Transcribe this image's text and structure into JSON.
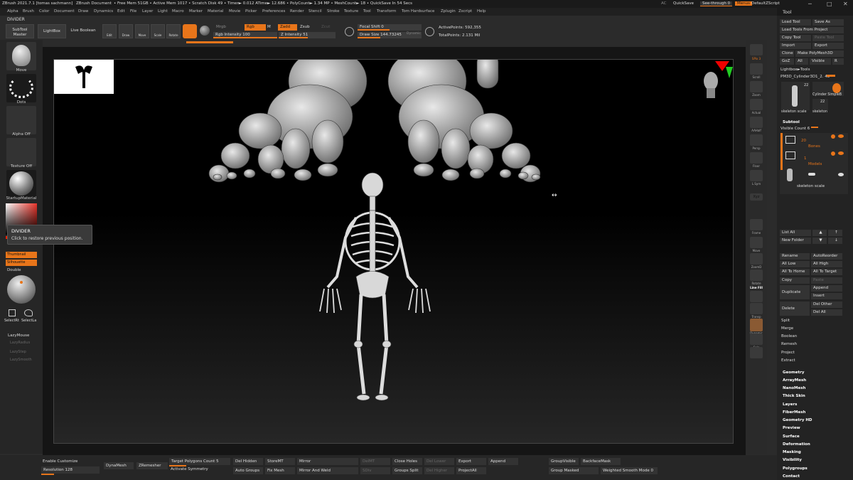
{
  "titlebar": {
    "app": "ZBrush 2021.7.1 [tomas sachmann]",
    "document": "ZBrush Document",
    "stats": "• Free Mem 51GB • Active Mem 1017 • Scratch Disk 49 • Timer► 0.012 ATime► 12.686 • PolyCount► 1.34 MP • MeshCount► 18 • QuickSave In 54 Secs",
    "ac": "AC",
    "quicksave": "QuickSave",
    "see_through": "See-through  0",
    "menus_btn": "Menus",
    "zscript": "DefaultZScript",
    "win_controls": [
      "─",
      "□",
      "✕"
    ]
  },
  "menubar": {
    "items": [
      "Alpha",
      "Brush",
      "Color",
      "Document",
      "Draw",
      "Dynamics",
      "Edit",
      "File",
      "Layer",
      "Light",
      "Macro",
      "Marker",
      "Material",
      "Movie",
      "Picker",
      "Preferences",
      "Render",
      "Stencil",
      "Stroke",
      "Texture",
      "Tool",
      "Transform",
      "Tom Hardsurface",
      "Zplugin",
      "Zscript",
      "Help"
    ]
  },
  "divider_label": "DIVIDER",
  "toolbar": {
    "subtool_master": "SubTool Master",
    "lightbox": "LightBox",
    "live_boolean": "Live Boolean",
    "edit": "Edit",
    "draw": "Draw",
    "move": "Move",
    "scale": "Scale",
    "rotate": "Rotate",
    "mrgb": "Mrgb",
    "rgb": "Rgb",
    "m": "M",
    "zadd": "Zadd",
    "zsub": "Zsub",
    "zcut": "Zcut",
    "rgb_intensity": "Rgb Intensity 100",
    "z_intensity": "Z Intensity 51",
    "focal_shift": "Focal Shift 0",
    "draw_size": "Draw Size 144.73245",
    "dynamic": "Dynamic",
    "active_points": "ActivePoints: 592,355",
    "total_points": "TotalPoints: 2.131 Mil"
  },
  "leftpanel": {
    "move": "Move",
    "dots": "Dots",
    "alpha_off": "Alpha Off",
    "texture_off": "Texture Off",
    "startup_material": "StartupMaterial",
    "gradient": "Gradient",
    "switch_color": "SwitchColor",
    "alternate": "Alternate",
    "thumbnail": "Thumbnail",
    "silhouette": "Silhouette",
    "double": "Double",
    "selectrect": "SelectRt",
    "selectlasso": "SelectLa",
    "lazymouse": "LazyMouse",
    "lazyradius": "LazyRadius",
    "lazystep": "LazyStep",
    "lazysmooth": "LazySmooth"
  },
  "tooltip": {
    "title": "DIVIDER",
    "text": "Click to restore previous position."
  },
  "rightshelf": {
    "items": [
      "BPR",
      "SPix 3",
      "Scroll",
      "Zoom",
      "Actual",
      "AAHalf",
      "Persp",
      "Floor",
      "L.Sym",
      "Xyz",
      "Frame",
      "Move",
      "ZoomD",
      "Rotate",
      "Line Fill",
      "Transp",
      "Dynamic",
      "Solo",
      "Xpose"
    ]
  },
  "toolpanel": {
    "title": "Tool",
    "load_tool": "Load Tool",
    "save_as": "Save As",
    "load_from_project": "Load Tools From Project",
    "copy_tool": "Copy Tool",
    "paste_tool": "Paste Tool",
    "import": "Import",
    "export": "Export",
    "clone": "Clone",
    "make_polymesh": "Make PolyMesh3D",
    "goz": "GoZ",
    "all": "All",
    "visible": "Visible",
    "r": "R",
    "lightbox_tools": "Lightbox►Tools",
    "pm3d_name": "PM3D_Cylinder3D1_2. 48",
    "thumb_count": "22",
    "cylinder_label": "Cylinder SimpleB",
    "skeleton_scale": "skeleton scale",
    "skeleton_label": "skeleton",
    "thumb2_count": "22",
    "subtool": "Subtool",
    "visible_count": "Visible Count 6",
    "folder1_count": "20",
    "folder1_name": "Bones",
    "folder2_count": "1",
    "folder2_name": "Models",
    "subtool_item": "skeleton scale",
    "list_all": "List All",
    "new_folder": "New Folder",
    "rename": "Rename",
    "autoreorder": "AutoReorder",
    "all_low": "All Low",
    "all_high": "All High",
    "all_to_home": "All To Home",
    "all_to_target": "All To Target",
    "copy": "Copy",
    "paste": "Paste",
    "append": "Append",
    "duplicate": "Duplicate",
    "insert": "Insert",
    "delete": "Delete",
    "del_other": "Del Other",
    "del_all": "Del All",
    "split": "Split",
    "merge": "Merge",
    "boolean": "Boolean",
    "remesh": "Remesh",
    "project": "Project",
    "extract": "Extract",
    "sections": [
      "Geometry",
      "ArrayMesh",
      "NanoMesh",
      "Thick Skin",
      "Layers",
      "FiberMesh",
      "Geometry HD",
      "Preview",
      "Surface",
      "Deformation",
      "Masking",
      "Visibility",
      "Polygroups",
      "Contact"
    ]
  },
  "bottombar": {
    "enable_customize": "Enable Customize",
    "resolution": "Resolution 128",
    "dynamesh": "DynaMesh",
    "zremesher": "ZRemesher",
    "target_poly": "Target Polygons Count 5",
    "activate_symmetry": "Activate Symmetry",
    "del_hidden": "Del Hidden",
    "auto_groups": "Auto Groups",
    "storemt": "StoreMT",
    "fix_mesh": "Fix Mesh",
    "mirror": "Mirror",
    "mirror_and_weld": "Mirror And Weld",
    "delmt": "DelMT",
    "sdiv": "SDiv",
    "close_holes": "Close Holes",
    "groups_split": "Groups Split",
    "del_lower": "Del Lower",
    "del_higher": "Del Higher",
    "export": "Export",
    "project_all": "ProjectAll",
    "append": "Append",
    "group_visible": "GroupVisible",
    "backface_mask": "BackfaceMask",
    "group_masked": "Group Masked",
    "weighted_smooth": "Weighted Smooth Mode 0"
  },
  "colors": {
    "accent": "#e8751a",
    "background": "#2b2b2b",
    "viewport": "#000000"
  }
}
